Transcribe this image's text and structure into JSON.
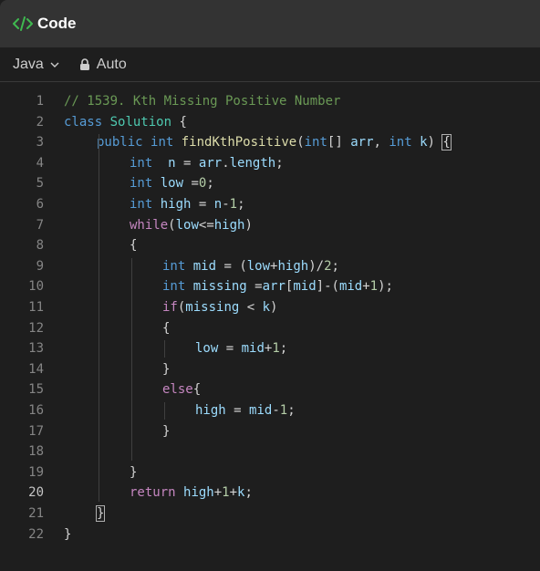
{
  "header": {
    "title": "Code",
    "icon": "code-icon"
  },
  "toolbar": {
    "language": "Java",
    "mode": "Auto"
  },
  "editor": {
    "active_line": 20,
    "lines": [
      {
        "n": "1",
        "tokens": [
          {
            "t": "// 1539. Kth Missing Positive Number",
            "c": "comment"
          }
        ]
      },
      {
        "n": "2",
        "tokens": [
          {
            "t": "class",
            "c": "kw"
          },
          {
            "t": " "
          },
          {
            "t": "Solution",
            "c": "type"
          },
          {
            "t": " {",
            "c": "punct"
          }
        ]
      },
      {
        "n": "3",
        "indent": 1,
        "tokens": [
          {
            "t": "public",
            "c": "kw"
          },
          {
            "t": " "
          },
          {
            "t": "int",
            "c": "kw"
          },
          {
            "t": " "
          },
          {
            "t": "findKthPositive",
            "c": "fn"
          },
          {
            "t": "(",
            "c": "punct"
          },
          {
            "t": "int",
            "c": "kw"
          },
          {
            "t": "[] ",
            "c": "punct"
          },
          {
            "t": "arr",
            "c": "var"
          },
          {
            "t": ", ",
            "c": "punct"
          },
          {
            "t": "int",
            "c": "kw"
          },
          {
            "t": " "
          },
          {
            "t": "k",
            "c": "var"
          },
          {
            "t": ") ",
            "c": "punct"
          },
          {
            "t": "{",
            "c": "box"
          }
        ]
      },
      {
        "n": "4",
        "indent": 2,
        "tokens": [
          {
            "t": "int",
            "c": "kw"
          },
          {
            "t": "  "
          },
          {
            "t": "n",
            "c": "var"
          },
          {
            "t": " = ",
            "c": "punct"
          },
          {
            "t": "arr",
            "c": "var"
          },
          {
            "t": ".",
            "c": "punct"
          },
          {
            "t": "length",
            "c": "var"
          },
          {
            "t": ";",
            "c": "punct"
          }
        ]
      },
      {
        "n": "5",
        "indent": 2,
        "tokens": [
          {
            "t": "int",
            "c": "kw"
          },
          {
            "t": " "
          },
          {
            "t": "low",
            "c": "var"
          },
          {
            "t": " =",
            "c": "punct"
          },
          {
            "t": "0",
            "c": "num"
          },
          {
            "t": ";",
            "c": "punct"
          }
        ]
      },
      {
        "n": "6",
        "indent": 2,
        "tokens": [
          {
            "t": "int",
            "c": "kw"
          },
          {
            "t": " "
          },
          {
            "t": "high",
            "c": "var"
          },
          {
            "t": " = ",
            "c": "punct"
          },
          {
            "t": "n",
            "c": "var"
          },
          {
            "t": "-",
            "c": "punct"
          },
          {
            "t": "1",
            "c": "num"
          },
          {
            "t": ";",
            "c": "punct"
          }
        ]
      },
      {
        "n": "7",
        "indent": 2,
        "tokens": [
          {
            "t": "while",
            "c": "ctrl"
          },
          {
            "t": "(",
            "c": "punct"
          },
          {
            "t": "low",
            "c": "var"
          },
          {
            "t": "<=",
            "c": "punct"
          },
          {
            "t": "high",
            "c": "var"
          },
          {
            "t": ")",
            "c": "punct"
          }
        ]
      },
      {
        "n": "8",
        "indent": 2,
        "tokens": [
          {
            "t": "{",
            "c": "punct"
          }
        ]
      },
      {
        "n": "9",
        "indent": 3,
        "tokens": [
          {
            "t": "int",
            "c": "kw"
          },
          {
            "t": " "
          },
          {
            "t": "mid",
            "c": "var"
          },
          {
            "t": " = (",
            "c": "punct"
          },
          {
            "t": "low",
            "c": "var"
          },
          {
            "t": "+",
            "c": "punct"
          },
          {
            "t": "high",
            "c": "var"
          },
          {
            "t": ")/",
            "c": "punct"
          },
          {
            "t": "2",
            "c": "num"
          },
          {
            "t": ";",
            "c": "punct"
          }
        ]
      },
      {
        "n": "10",
        "indent": 3,
        "tokens": [
          {
            "t": "int",
            "c": "kw"
          },
          {
            "t": " "
          },
          {
            "t": "missing",
            "c": "var"
          },
          {
            "t": " =",
            "c": "punct"
          },
          {
            "t": "arr",
            "c": "var"
          },
          {
            "t": "[",
            "c": "punct"
          },
          {
            "t": "mid",
            "c": "var"
          },
          {
            "t": "]-(",
            "c": "punct"
          },
          {
            "t": "mid",
            "c": "var"
          },
          {
            "t": "+",
            "c": "punct"
          },
          {
            "t": "1",
            "c": "num"
          },
          {
            "t": ");",
            "c": "punct"
          }
        ]
      },
      {
        "n": "11",
        "indent": 3,
        "tokens": [
          {
            "t": "if",
            "c": "ctrl"
          },
          {
            "t": "(",
            "c": "punct"
          },
          {
            "t": "missing",
            "c": "var"
          },
          {
            "t": " < ",
            "c": "punct"
          },
          {
            "t": "k",
            "c": "var"
          },
          {
            "t": ")",
            "c": "punct"
          }
        ]
      },
      {
        "n": "12",
        "indent": 3,
        "tokens": [
          {
            "t": "{",
            "c": "punct"
          }
        ]
      },
      {
        "n": "13",
        "indent": 4,
        "tokens": [
          {
            "t": "low",
            "c": "var"
          },
          {
            "t": " = ",
            "c": "punct"
          },
          {
            "t": "mid",
            "c": "var"
          },
          {
            "t": "+",
            "c": "punct"
          },
          {
            "t": "1",
            "c": "num"
          },
          {
            "t": ";",
            "c": "punct"
          }
        ]
      },
      {
        "n": "14",
        "indent": 3,
        "tokens": [
          {
            "t": "}",
            "c": "punct"
          }
        ]
      },
      {
        "n": "15",
        "indent": 3,
        "tokens": [
          {
            "t": "else",
            "c": "ctrl"
          },
          {
            "t": "{",
            "c": "punct"
          }
        ]
      },
      {
        "n": "16",
        "indent": 4,
        "tokens": [
          {
            "t": "high",
            "c": "var"
          },
          {
            "t": " = ",
            "c": "punct"
          },
          {
            "t": "mid",
            "c": "var"
          },
          {
            "t": "-",
            "c": "punct"
          },
          {
            "t": "1",
            "c": "num"
          },
          {
            "t": ";",
            "c": "punct"
          }
        ]
      },
      {
        "n": "17",
        "indent": 3,
        "tokens": [
          {
            "t": "}",
            "c": "punct"
          }
        ]
      },
      {
        "n": "18",
        "indent": 0,
        "tokens": []
      },
      {
        "n": "19",
        "indent": 2,
        "tokens": [
          {
            "t": "}",
            "c": "punct"
          }
        ]
      },
      {
        "n": "20",
        "indent": 2,
        "tokens": [
          {
            "t": "return",
            "c": "ctrl"
          },
          {
            "t": " "
          },
          {
            "t": "high",
            "c": "var"
          },
          {
            "t": "+",
            "c": "punct"
          },
          {
            "t": "1",
            "c": "num"
          },
          {
            "t": "+",
            "c": "punct"
          },
          {
            "t": "k",
            "c": "var"
          },
          {
            "t": ";",
            "c": "punct"
          }
        ]
      },
      {
        "n": "21",
        "indent": 1,
        "tokens": [
          {
            "t": "}",
            "c": "box"
          }
        ]
      },
      {
        "n": "22",
        "indent": 0,
        "tokens": [
          {
            "t": "}",
            "c": "punct"
          }
        ]
      }
    ]
  }
}
